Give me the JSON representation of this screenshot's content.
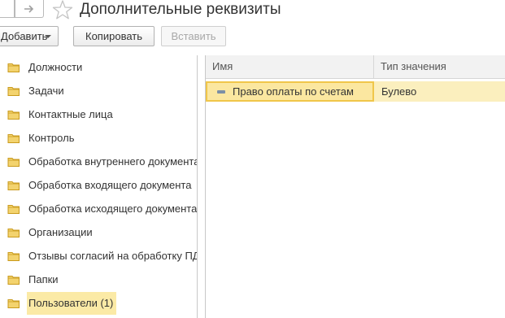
{
  "window": {
    "title": "Дополнительные реквизиты"
  },
  "toolbar": {
    "add_label": "Добавить",
    "copy_label": "Копировать",
    "paste_label": "Вставить"
  },
  "folders": [
    {
      "label": "Должности"
    },
    {
      "label": "Задачи"
    },
    {
      "label": "Контактные лица"
    },
    {
      "label": "Контроль"
    },
    {
      "label": "Обработка внутреннего документа"
    },
    {
      "label": "Обработка входящего документа"
    },
    {
      "label": "Обработка исходящего документа"
    },
    {
      "label": "Организации"
    },
    {
      "label": "Отзывы согласий на обработку ПД"
    },
    {
      "label": "Папки"
    },
    {
      "label": "Пользователи (1)",
      "selected": true
    }
  ],
  "table": {
    "columns": [
      "Имя",
      "Тип значения"
    ],
    "rows": [
      {
        "name": "Право оплаты по счетам",
        "type": "Булево"
      }
    ]
  },
  "colors": {
    "selection": "#fbe7a0",
    "selection_border": "#f0c64a",
    "folder": "#e8c04a"
  }
}
